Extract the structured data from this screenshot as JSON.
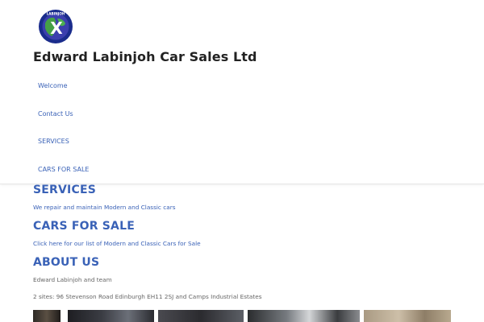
{
  "site": {
    "logo_text": "LABINJOH",
    "logo_letter": "X",
    "title": "Edward Labinjoh Car Sales Ltd"
  },
  "nav": {
    "items": [
      {
        "label": "Welcome"
      },
      {
        "label": "Contact Us"
      },
      {
        "label": "SERVICES"
      },
      {
        "label": "CARS FOR SALE"
      }
    ]
  },
  "content": {
    "services": {
      "heading": "SERVICES",
      "text": "We repair and maintain Modern and Classic cars"
    },
    "cars_for_sale": {
      "heading": "CARS FOR SALE",
      "link": "Click here for our list of Modern and Classic Cars for Sale"
    },
    "about": {
      "heading": "ABOUT US",
      "line1": "Edward Labinjoh and team",
      "line2": "2 sites: 96 Stevenson Road Edinburgh EH11 2SJ and Camps Industrial Estates"
    }
  },
  "colors": {
    "accent": "#3a62b7",
    "title": "#222222",
    "body_text": "#666666",
    "logo_ring": "#1a2c8c"
  },
  "gallery": {
    "photos": [
      {
        "alt": "car-photo-1"
      },
      {
        "alt": "car-photo-2"
      },
      {
        "alt": "car-photo-3"
      },
      {
        "alt": "car-photo-4"
      },
      {
        "alt": "car-photo-5"
      }
    ]
  }
}
